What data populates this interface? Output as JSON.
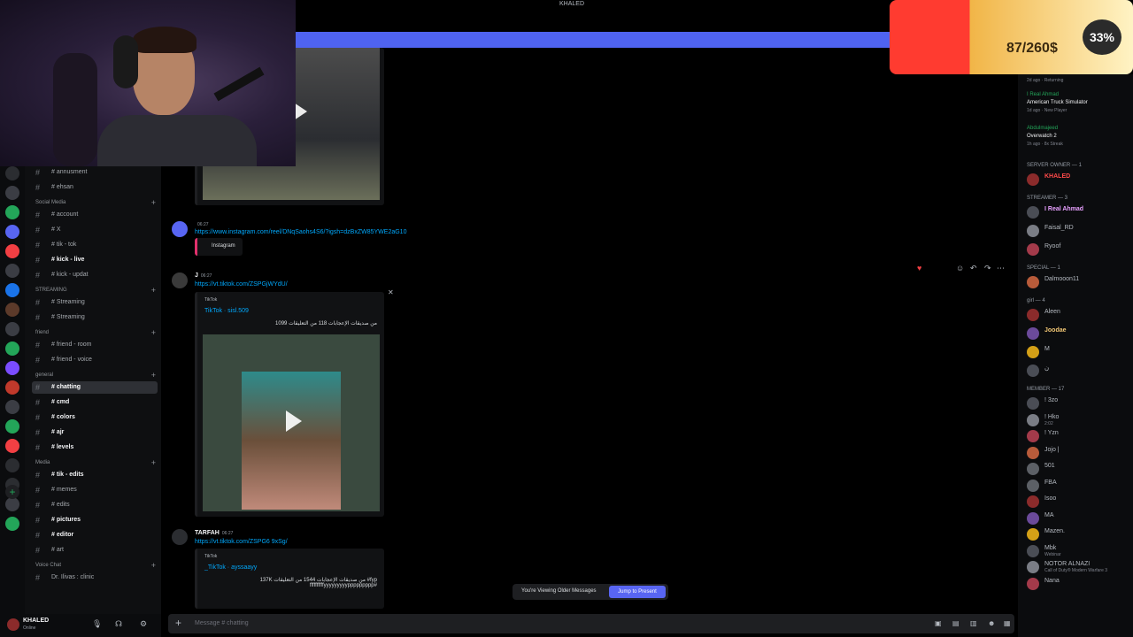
{
  "window": {
    "title": "KHALED"
  },
  "stream": {
    "progress_fraction": 0.92,
    "donation": {
      "amount": "87/260$",
      "percent": "33%",
      "fill_fraction": 0.33
    }
  },
  "sidebar": {
    "groups": [
      {
        "category": "",
        "channels": [
          {
            "label": "# annusment",
            "bold": false
          },
          {
            "label": "# ehsan",
            "bold": false
          }
        ]
      },
      {
        "category": "Social Media",
        "channels": [
          {
            "label": "# account",
            "bold": false
          },
          {
            "label": "# X",
            "bold": false
          },
          {
            "label": "# tik - tok",
            "bold": false
          },
          {
            "label": "# kick - live",
            "bold": true
          },
          {
            "label": "# kick - updat",
            "bold": false
          }
        ]
      },
      {
        "category": "STREAMING",
        "channels": [
          {
            "label": "# Streaming",
            "bold": false
          },
          {
            "label": "# Streaming",
            "bold": false
          }
        ]
      },
      {
        "category": "friend",
        "channels": [
          {
            "label": "# friend - room",
            "bold": false
          },
          {
            "label": "# friend - voice",
            "bold": false
          }
        ]
      },
      {
        "category": "general",
        "channels": [
          {
            "label": "# chatting",
            "bold": true,
            "active": true
          },
          {
            "label": "# cmd",
            "bold": true
          },
          {
            "label": "# colors",
            "bold": true
          },
          {
            "label": "# ajr",
            "bold": true
          },
          {
            "label": "# levels",
            "bold": true
          }
        ]
      },
      {
        "category": "Media",
        "channels": [
          {
            "label": "# tik - edits",
            "bold": true
          },
          {
            "label": "# memes",
            "bold": false
          },
          {
            "label": "# edits",
            "bold": false
          },
          {
            "label": "# pictures",
            "bold": true
          },
          {
            "label": "# editor",
            "bold": true
          },
          {
            "label": "# art",
            "bold": false
          }
        ]
      },
      {
        "category": "Voice Chat",
        "channels": [
          {
            "label": "Dr. Ilivas : clinic",
            "bold": false
          }
        ]
      }
    ],
    "user": {
      "name": "KHALED",
      "status": "Online"
    }
  },
  "chat": {
    "messages": [
      {
        "user": "",
        "time": "06:27",
        "link": "https://www.instagram.com/reel/DNqSaohs4S6/?igsh=dzBxZW85YWE2aG10",
        "embed_provider": "Instagram"
      },
      {
        "user": "J",
        "time": "06:27",
        "link": "https://vt.tiktok.com/ZSPGjWYdU/",
        "embed_provider": "TikTok",
        "embed_title": "TikTok · sisl.509",
        "embed_desc": "1099 من صديقات الإعجابات 118 من التعليقات"
      },
      {
        "user": "TARFAH",
        "time": "06:27",
        "link": "https://vt.tiktok.com/ZSPG6 9xSg/",
        "embed_provider": "TikTok",
        "embed_title": "_TikTok · ayssaayy",
        "embed_desc": "137K من صديقات الإعجابات 1544 من التعليقات #fyp ffffffffffyyyyyyyyyppppppppp#"
      }
    ],
    "jump": {
      "notice": "You're Viewing Older Messages",
      "button": "Jump to Present"
    },
    "composer": {
      "placeholder": "Message # chatting"
    }
  },
  "members": {
    "activities": [
      {
        "name": "",
        "status": "2d ago · Returning"
      },
      {
        "name": "I Real Ahmad",
        "game": "American Truck Simulator",
        "status": "1d ago · New Player"
      },
      {
        "name": "Abdulmajeed",
        "game": "Overwatch 2",
        "status": "1h ago · 8x Streak"
      }
    ],
    "groups": [
      {
        "header": "SERVER OWNER — 1",
        "users": [
          {
            "name": "KHALED",
            "sub": "",
            "color": "#ff4a4a"
          }
        ]
      },
      {
        "header": "STREAMER — 3",
        "users": [
          {
            "name": "I Real Ahmad",
            "sub": "",
            "color": "#e8a0ff"
          },
          {
            "name": "Faisal_RD",
            "sub": "",
            "color": "#b5bac1"
          },
          {
            "name": "Ryoof",
            "sub": "",
            "color": "#b5bac1"
          }
        ]
      },
      {
        "header": "SPECIAL — 1",
        "users": [
          {
            "name": "Dalmooon11",
            "sub": "",
            "color": "#b5bac1"
          }
        ]
      },
      {
        "header": "girl — 4",
        "users": [
          {
            "name": "Aleen",
            "sub": "",
            "color": "#b5bac1"
          },
          {
            "name": "Joodae",
            "sub": "",
            "color": "#f0c674"
          },
          {
            "name": "M",
            "sub": "",
            "color": "#b5bac1"
          },
          {
            "name": "ن",
            "sub": "",
            "color": "#b5bac1"
          }
        ]
      },
      {
        "header": "MEMBER — 17",
        "users": [
          {
            "name": "! 3zo",
            "sub": "",
            "color": "#b5bac1"
          },
          {
            "name": "! Hko",
            "sub": "2:02",
            "color": "#b5bac1"
          },
          {
            "name": "! Yzn",
            "sub": "",
            "color": "#b5bac1"
          },
          {
            "name": "Jojo |",
            "sub": "",
            "color": "#b5bac1"
          },
          {
            "name": "501",
            "sub": "",
            "color": "#b5bac1"
          },
          {
            "name": "FBA",
            "sub": "",
            "color": "#b5bac1"
          },
          {
            "name": "Isoo",
            "sub": "",
            "color": "#b5bac1"
          },
          {
            "name": "MA",
            "sub": "",
            "color": "#b5bac1"
          },
          {
            "name": "Mazen.",
            "sub": "",
            "color": "#b5bac1"
          },
          {
            "name": "Mbk",
            "sub": "Webinar",
            "color": "#b5bac1"
          },
          {
            "name": "NOTOR ALNAZI",
            "sub": "Call of Duty® Modern Warfare 3",
            "color": "#b5bac1"
          },
          {
            "name": "Nana",
            "sub": "",
            "color": "#b5bac1"
          }
        ]
      }
    ]
  },
  "colors": {
    "accent": "#5865f2",
    "progress": "#4f63f0",
    "link": "#00a8fc",
    "donation_red": "#ff3b30",
    "donation_gold": "#f1b547"
  },
  "icons": [
    "mic-icon",
    "headphones-icon",
    "gear-icon",
    "plus-icon",
    "gift-icon",
    "gif-icon",
    "sticker-icon",
    "emoji-icon",
    "apps-icon",
    "play-icon",
    "close-icon"
  ]
}
